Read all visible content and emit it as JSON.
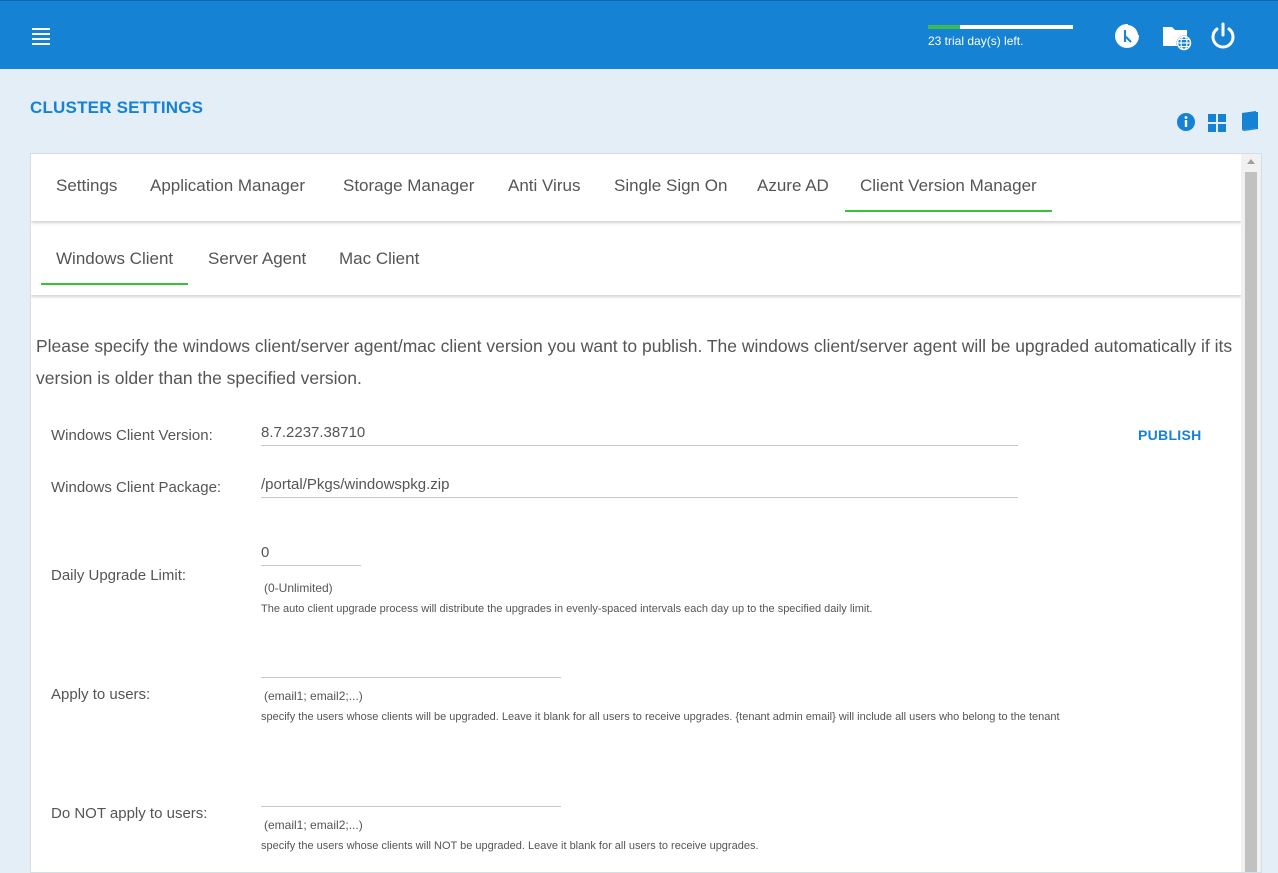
{
  "topbar": {
    "menu_icon": "hamburger-menu-icon",
    "trial_text": "23 trial day(s) left.",
    "trial_progress": 0.22,
    "icons": [
      "dashboard-pie-icon",
      "cloud-folder-icon",
      "power-icon"
    ]
  },
  "header": {
    "title": "CLUSTER SETTINGS",
    "icons": [
      "info-icon",
      "grid-icon",
      "book-icon"
    ]
  },
  "tabs": [
    {
      "label": "Settings"
    },
    {
      "label": "Application Manager"
    },
    {
      "label": "Storage Manager"
    },
    {
      "label": "Anti Virus"
    },
    {
      "label": "Single Sign On"
    },
    {
      "label": "Azure AD"
    },
    {
      "label": "Client Version Manager",
      "active": true
    }
  ],
  "subtabs": [
    {
      "label": "Windows Client",
      "active": true
    },
    {
      "label": "Server Agent"
    },
    {
      "label": "Mac Client"
    }
  ],
  "description": "Please specify the windows client/server agent/mac client version you want to publish. The windows client/server agent will be upgraded automatically if its version is older than the specified version.",
  "form": {
    "version_label": "Windows Client Version:",
    "version_value": "8.7.2237.38710",
    "publish_label": "PUBLISH",
    "package_label": "Windows Client Package:",
    "package_value": "/portal/Pkgs/windowspkg.zip",
    "daily_label": "Daily Upgrade Limit:",
    "daily_value": "0",
    "daily_hint": "(0-Unlimited)",
    "daily_note": "The auto client upgrade process will distribute the upgrades in evenly-spaced intervals each day up to the specified daily limit.",
    "apply_label": "Apply to users:",
    "apply_value": "",
    "apply_hint": "(email1; email2;...)",
    "apply_note": "specify the users whose clients will be upgraded. Leave it blank for all users to receive upgrades. {tenant admin email} will include all users who belong to the tenant",
    "notapply_label": "Do NOT apply to users:",
    "notapply_value": "",
    "notapply_hint": "(email1; email2;...)",
    "notapply_note": "specify the users whose clients will NOT be upgraded. Leave it blank for all users to receive upgrades."
  },
  "colors": {
    "brand": "#1682d4",
    "active_tab": "#35c435",
    "background": "#e3eef7"
  }
}
